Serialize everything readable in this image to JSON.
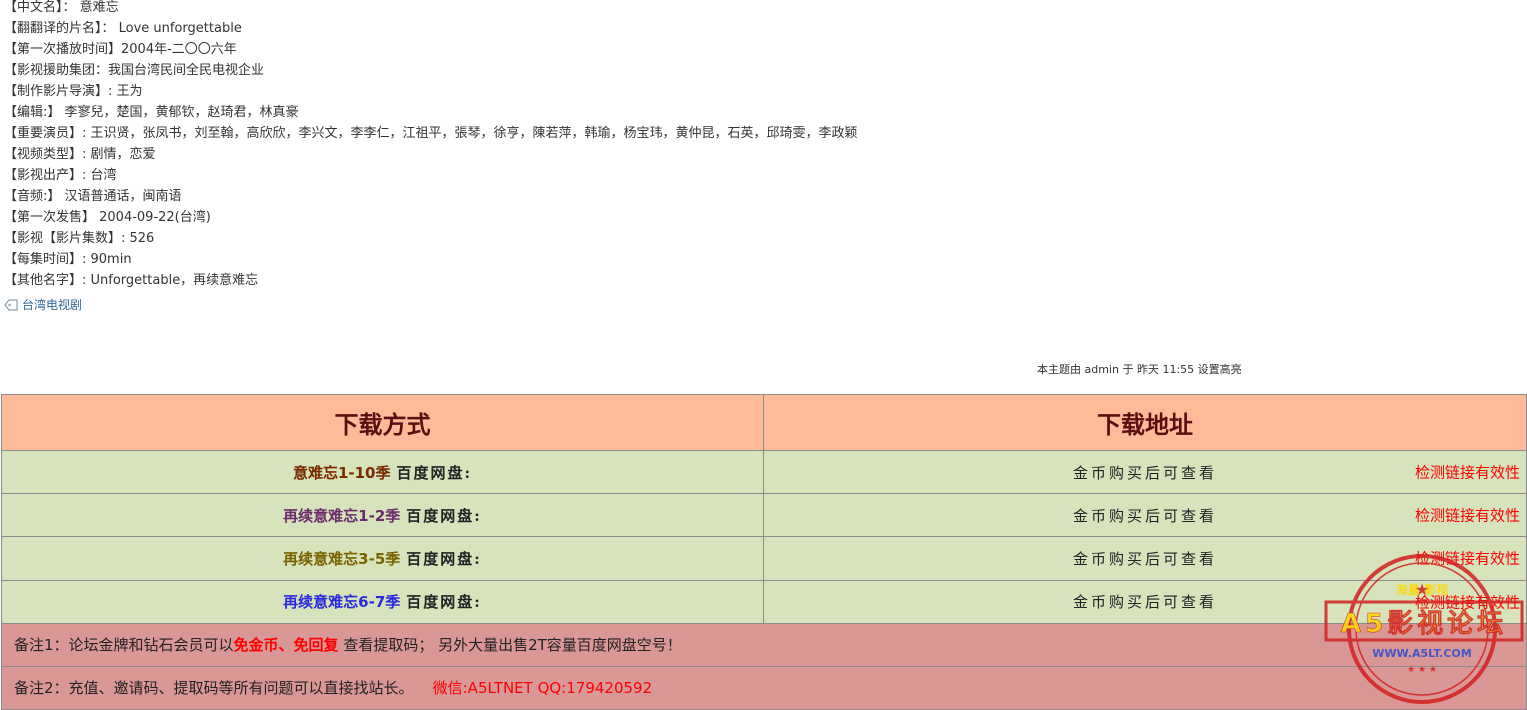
{
  "info": [
    "【中文名】：  意难忘",
    "【翻翻译的片名】：  Love unforgettable",
    "【第一次播放时间】2004年-二〇〇六年",
    "【影视援助集团：我国台湾民间全民电视企业",
    "【制作影片导演】: 王为",
    "【编辑:】  李寥兒，楚国，黄郁钦，赵琦君，林真豪",
    "【重要演员】: 王识贤，张凤书，刘至翰，高欣欣，李兴文，李李仁，江祖平，張琴，徐亨，陳若萍，韩瑜，杨宝玮，黄仲昆，石英，邱琦雯，李政颖",
    "【视频类型】: 剧情，恋爱",
    "【影视出产】: 台湾",
    "【音频:】  汉语普通话，闽南语",
    "【第一次发售】  2004-09-22(台湾)",
    "【影视【影片集数】: 526",
    "【每集时间】: 90min",
    "【其他名字】: Unforgettable，再续意难忘"
  ],
  "tag": {
    "label": "台湾电视剧"
  },
  "highlight_note": "本主题由 admin 于 昨天 11:55 设置高亮",
  "table": {
    "headers": [
      "下载方式",
      "下载地址"
    ],
    "rows": [
      {
        "name": "意难忘1-10季",
        "color": "#7a2a00",
        "disk": "百度网盘:",
        "address": "金币购买后可查看",
        "check": "检测链接有效性"
      },
      {
        "name": "再续意难忘1-2季",
        "color": "#6b2c6b",
        "disk": "百度网盘:",
        "address": "金币购买后可查看",
        "check": "检测链接有效性"
      },
      {
        "name": "再续意难忘3-5季",
        "color": "#7a6200",
        "disk": "百度网盘:",
        "address": "金币购买后可查看",
        "check": "检测链接有效性"
      },
      {
        "name": "再续意难忘6-7季",
        "color": "#2a2ae0",
        "disk": "百度网盘:",
        "address": "金币购买后可查看",
        "check": "检测链接有效性"
      }
    ],
    "note1": {
      "prefix": "备注1：论坛金牌和钻石会员可以",
      "highlight": "免金币、免回复",
      "suffix": " 查看提取码；  另外大量出售2T容量百度网盘空号！"
    },
    "note2": {
      "prefix": "备注2：充值、邀请码、提取码等所有问题可以直接找站长。    ",
      "contact": "微信:A5LTNET QQ:179420592"
    }
  },
  "stamp": {
    "top_text": "海量    影视",
    "main_text": "A5影视论坛",
    "url": "WWW.A5LT.COM",
    "color": "#d42020",
    "accent": "#ffd700"
  }
}
